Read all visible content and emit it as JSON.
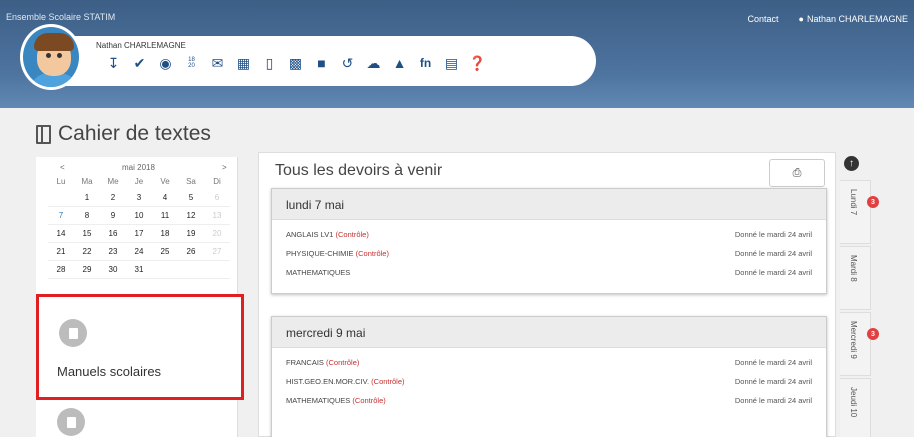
{
  "header": {
    "school": "Ensemble Scolaire STATIM",
    "contact": "Contact",
    "user": "Nathan CHARLEMAGNE",
    "toolbar_name": "Nathan CHARLEMAGNE",
    "date_icon_top": "18",
    "date_icon_bottom": "20",
    "icons": [
      "grades-icon",
      "schedule-icon",
      "messages-icon",
      "grades-fraction-icon",
      "mail-icon",
      "calendar-icon",
      "notebook-icon",
      "textbook-icon",
      "folder-icon",
      "history-icon",
      "cloud-icon",
      "groups-icon",
      "fn-icon",
      "book-icon",
      "help-icon"
    ]
  },
  "page": {
    "title": "Cahier de textes"
  },
  "calendar": {
    "prev": "<",
    "month": "mai 2018",
    "next": ">",
    "days": [
      "Lu",
      "Ma",
      "Me",
      "Je",
      "Ve",
      "Sa",
      "Di"
    ],
    "weeks": [
      [
        "",
        "1",
        "2",
        "3",
        "4",
        "5",
        "6"
      ],
      [
        "7",
        "8",
        "9",
        "10",
        "11",
        "12",
        "13"
      ],
      [
        "14",
        "15",
        "16",
        "17",
        "18",
        "19",
        "20"
      ],
      [
        "21",
        "22",
        "23",
        "24",
        "25",
        "26",
        "27"
      ],
      [
        "28",
        "29",
        "30",
        "31",
        "",
        "",
        ""
      ]
    ]
  },
  "sidebar": {
    "manuels_label": "Manuels scolaires"
  },
  "main": {
    "title": "Tous les devoirs à venir",
    "print_icon": "printer-icon",
    "days": [
      {
        "label": "lundi 7 mai",
        "rows": [
          {
            "subject": "ANGLAIS LV1",
            "tag": "(Contrôle)",
            "given": "Donné le mardi 24 avril"
          },
          {
            "subject": "PHYSIQUE-CHIMIE",
            "tag": "(Contrôle)",
            "given": "Donné le mardi 24 avril"
          },
          {
            "subject": "MATHEMATIQUES",
            "tag": "",
            "given": "Donné le mardi 24 avril"
          }
        ]
      },
      {
        "label": "mercredi 9 mai",
        "rows": [
          {
            "subject": "FRANCAIS",
            "tag": "(Contrôle)",
            "given": "Donné le mardi 24 avril"
          },
          {
            "subject": "HIST.GEO.EN.MOR.CIV.",
            "tag": "(Contrôle)",
            "given": "Donné le mardi 24 avril"
          },
          {
            "subject": "MATHEMATIQUES",
            "tag": "(Contrôle)",
            "given": "Donné le mardi 24 avril"
          }
        ]
      }
    ]
  },
  "tabs": [
    {
      "label": "Lundi 7",
      "badge": "3"
    },
    {
      "label": "Mardi 8",
      "badge": ""
    },
    {
      "label": "Mercredi 9",
      "badge": "3"
    },
    {
      "label": "Jeudi 10",
      "badge": ""
    }
  ],
  "colors": {
    "accent": "#1f4f86",
    "header": "#4e74a0",
    "alert": "#e02020",
    "control": "#c43030"
  }
}
